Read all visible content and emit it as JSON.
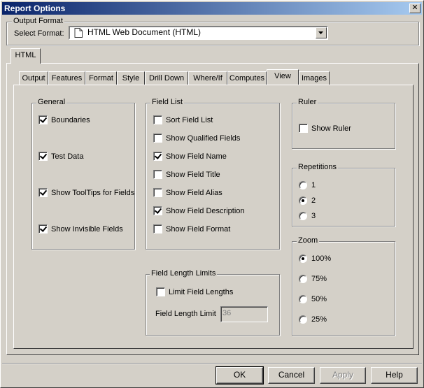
{
  "window": {
    "title": "Report Options",
    "close_glyph": "✕"
  },
  "output_format": {
    "group_label": "Output Format",
    "select_label": "Select Format:",
    "selected_value": "HTML Web Document (HTML)"
  },
  "outer_tab": {
    "label": "HTML"
  },
  "tabs": [
    {
      "label": "Output"
    },
    {
      "label": "Features"
    },
    {
      "label": "Format"
    },
    {
      "label": "Style"
    },
    {
      "label": "Drill Down"
    },
    {
      "label": "Where/If"
    },
    {
      "label": "Computes"
    },
    {
      "label": "View",
      "active": true
    },
    {
      "label": "Images"
    }
  ],
  "general": {
    "label": "General",
    "items": [
      {
        "label": "Boundaries",
        "checked": true
      },
      {
        "label": "Test Data",
        "checked": true
      },
      {
        "label": "Show ToolTips for Fields",
        "checked": true
      },
      {
        "label": "Show Invisible Fields",
        "checked": true
      }
    ]
  },
  "field_list": {
    "label": "Field List",
    "items": [
      {
        "label": "Sort Field List",
        "checked": false
      },
      {
        "label": "Show Qualified Fields",
        "checked": false
      },
      {
        "label": "Show Field Name",
        "checked": true
      },
      {
        "label": "Show Field Title",
        "checked": false
      },
      {
        "label": "Show Field Alias",
        "checked": false
      },
      {
        "label": "Show Field Description",
        "checked": true
      },
      {
        "label": "Show Field Format",
        "checked": false
      }
    ]
  },
  "field_length_limits": {
    "label": "Field Length Limits",
    "limit_checkbox_label": "Limit Field Lengths",
    "limit_checked": false,
    "limit_field_label": "Field Length Limit",
    "limit_value": "36"
  },
  "ruler": {
    "label": "Ruler",
    "show_ruler_label": "Show Ruler",
    "checked": false
  },
  "repetitions": {
    "label": "Repetitions",
    "options": [
      {
        "label": "1"
      },
      {
        "label": "2",
        "selected": true
      },
      {
        "label": "3"
      }
    ]
  },
  "zoom": {
    "label": "Zoom",
    "options": [
      {
        "label": "100%",
        "selected": true
      },
      {
        "label": "75%"
      },
      {
        "label": "50%"
      },
      {
        "label": "25%"
      }
    ]
  },
  "buttons": {
    "ok": "OK",
    "cancel": "Cancel",
    "apply": "Apply",
    "help": "Help"
  },
  "icons": {
    "document": "document-icon",
    "dropdown": "chevron-down-icon",
    "close": "close-icon"
  }
}
